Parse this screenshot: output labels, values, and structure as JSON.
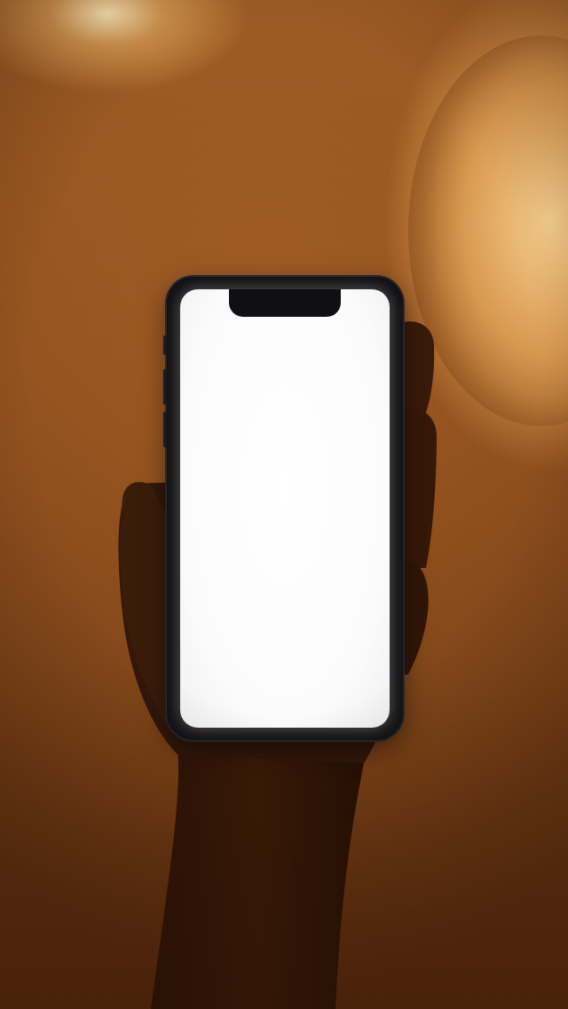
{
  "image": {
    "subject": "hand-holding-phone",
    "screen_state": "blank-white",
    "colors": {
      "background_warm": "#9a5a24",
      "light_glow": "#fcd696",
      "phone_frame": "#101014",
      "screen": "#ffffff",
      "hand_silhouette": "#2c1406"
    }
  }
}
